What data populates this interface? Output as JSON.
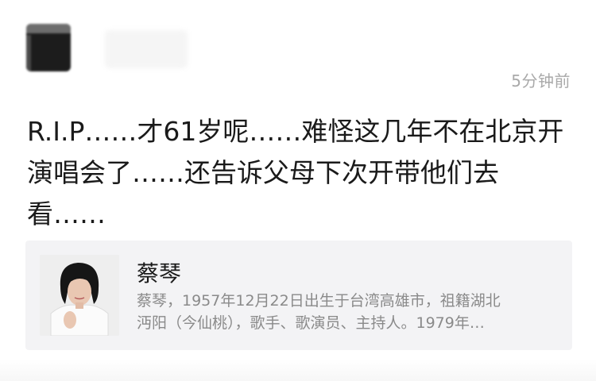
{
  "post": {
    "timestamp": "5分钟前",
    "text": "R.I.P……才61岁呢……难怪这几年不在北京开\n演唱会了……还告诉父母下次开带他们去\n看……"
  },
  "link_card": {
    "title": "蔡琴",
    "description": "蔡琴，1957年12月22日出生于台湾高雄市，祖籍湖北\n沔阳（今仙桃），歌手、歌演员、主持人。1979年…"
  }
}
